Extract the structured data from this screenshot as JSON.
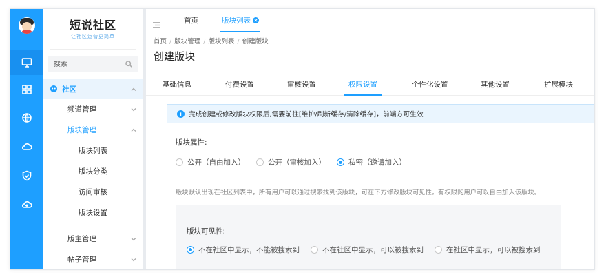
{
  "brand": {
    "title": "短说社区",
    "subtitle": "让社区运营更简单"
  },
  "search": {
    "placeholder": "搜索"
  },
  "sidebar": {
    "root": "社区",
    "items": [
      {
        "label": "频道管理"
      },
      {
        "label": "版块管理"
      },
      {
        "label": "版块列表"
      },
      {
        "label": "版块分类"
      },
      {
        "label": "访问审核"
      },
      {
        "label": "版块设置"
      },
      {
        "label": "版主管理"
      },
      {
        "label": "帖子管理"
      }
    ]
  },
  "topbar": {
    "tabs": [
      {
        "label": "首页"
      },
      {
        "label": "版块列表"
      }
    ]
  },
  "breadcrumb": [
    "首页",
    "版块管理",
    "版块列表",
    "创建版块"
  ],
  "page_title": "创建版块",
  "tabs": [
    {
      "label": "基础信息"
    },
    {
      "label": "付费设置"
    },
    {
      "label": "审核设置"
    },
    {
      "label": "权限设置"
    },
    {
      "label": "个性化设置"
    },
    {
      "label": "其他设置"
    },
    {
      "label": "扩展模块"
    }
  ],
  "notice": "完成创建或修改版块权限后,需要前往[维护/刷新缓存/清除缓存]，前端方可生效",
  "attribute": {
    "label": "版块属性:",
    "options": [
      "公开（自由加入）",
      "公开（审核加入）",
      "私密（邀请加入）"
    ],
    "selected": 2,
    "help": "版块默认出现在社区列表中，所有用户可以通过搜索找到该版块，可在下方修改版块可见性。有权限的用户可以自由加入该版块。"
  },
  "visibility": {
    "label": "版块可见性:",
    "options": [
      "不在社区中显示，不能被搜索到",
      "不在社区中显示，可以被搜索到",
      "在社区中显示，可以被搜索到"
    ],
    "selected": 0
  },
  "colors": {
    "accent": "#1e9fff",
    "rail": "#1e9fff"
  }
}
